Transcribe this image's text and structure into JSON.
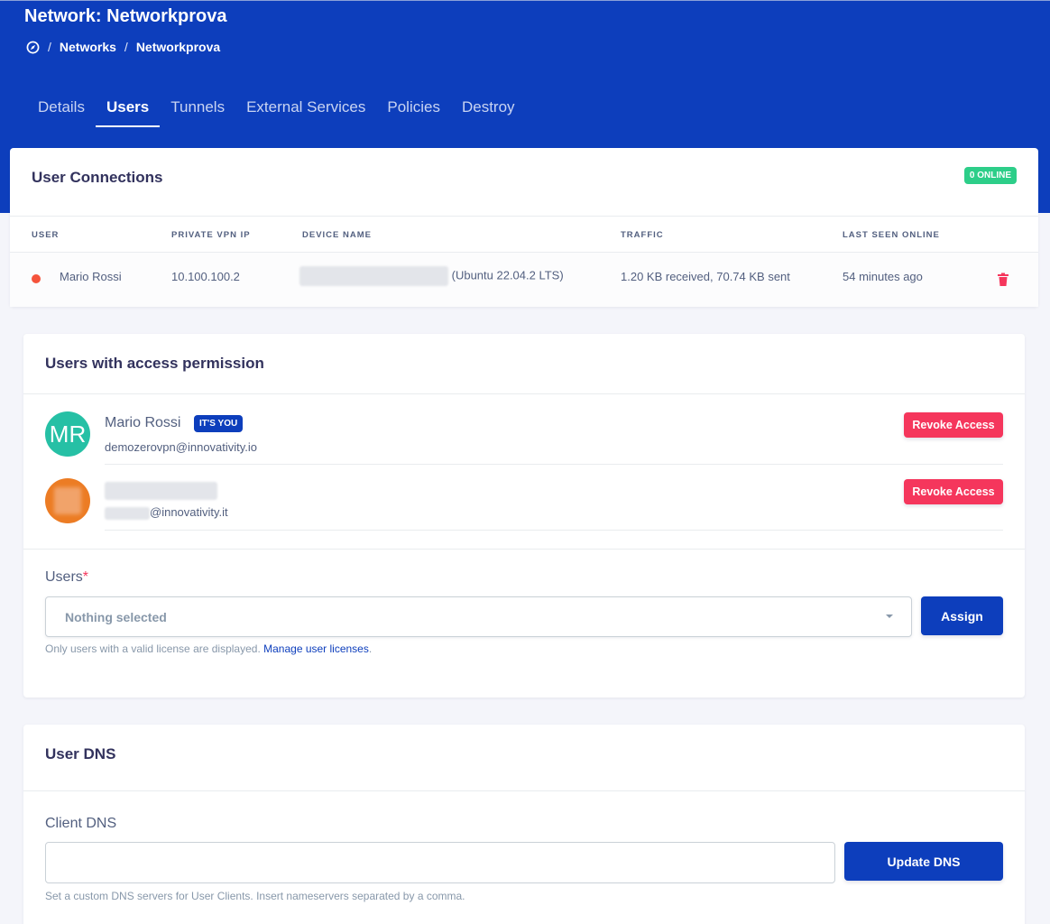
{
  "header": {
    "title": "Network: Networkprova",
    "breadcrumb": [
      "Networks",
      "Networkprova"
    ],
    "breadcrumb_separator": "/"
  },
  "tabs": [
    {
      "label": "Details",
      "active": false
    },
    {
      "label": "Users",
      "active": true
    },
    {
      "label": "Tunnels",
      "active": false
    },
    {
      "label": "External Services",
      "active": false
    },
    {
      "label": "Policies",
      "active": false
    },
    {
      "label": "Destroy",
      "active": false
    }
  ],
  "connections": {
    "title": "User Connections",
    "online_badge": "0 ONLINE",
    "columns": [
      "USER",
      "PRIVATE VPN IP",
      "DEVICE NAME",
      "TRAFFIC",
      "LAST SEEN ONLINE"
    ],
    "rows": [
      {
        "user": "Mario Rossi",
        "status_color": "#f5533b",
        "ip": "10.100.100.2",
        "device_suffix": "(Ubuntu 22.04.2 LTS)",
        "traffic": "1.20 KB received, 70.74 KB sent",
        "last_seen": "54 minutes ago"
      }
    ]
  },
  "access": {
    "title": "Users with access permission",
    "users": [
      {
        "initials": "MR",
        "name": "Mario Rossi",
        "badge": "IT'S YOU",
        "email": "demozerovpn@innovativity.io",
        "avatar_color": "#26c0a5",
        "revoke_label": "Revoke Access"
      },
      {
        "initials": "",
        "name": "",
        "badge": "",
        "email_suffix": "@innovativity.it",
        "avatar_color": "#ec7c24",
        "revoke_label": "Revoke Access"
      }
    ],
    "assign": {
      "label": "Users",
      "required_mark": "*",
      "placeholder": "Nothing selected",
      "button": "Assign",
      "help_text": "Only users with a valid license are displayed.",
      "help_link": "Manage user licenses",
      "help_end": "."
    }
  },
  "dns": {
    "title": "User DNS",
    "field_label": "Client DNS",
    "value": "",
    "button": "Update DNS",
    "help_text": "Set a custom DNS servers for User Clients. Insert nameservers separated by a comma."
  },
  "colors": {
    "brand": "#0d3ebc",
    "danger": "#f5365c",
    "success": "#2dce89"
  }
}
